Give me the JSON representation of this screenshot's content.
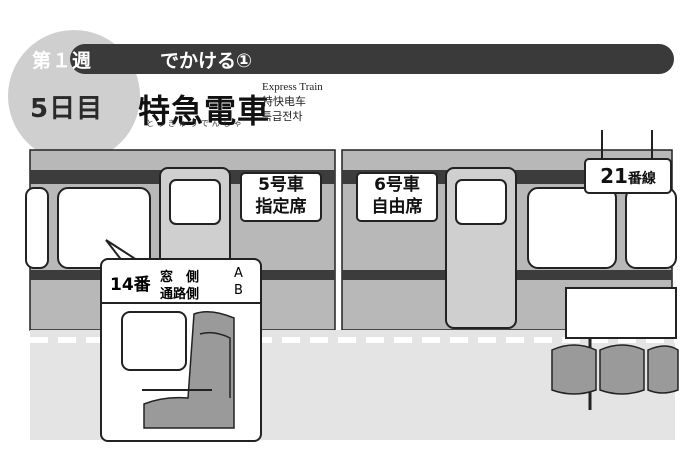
{
  "header": {
    "week": "第１週",
    "title": "でかける①",
    "day": "5日目",
    "heading": "特急電車",
    "reading": "とっきゅうでんしゃ",
    "translations": [
      "Express Train",
      "特快电车",
      "특급전차"
    ]
  },
  "train": {
    "car5": {
      "number": "5号車",
      "type": "指定席"
    },
    "car6": {
      "number": "6号車",
      "type": "自由席"
    }
  },
  "platform_sign": {
    "prefix": "21",
    "suffix": "番線"
  },
  "seat_info": {
    "number": "14番",
    "rows": [
      {
        "label": "窓　側",
        "letter": "A"
      },
      {
        "label": "通路側",
        "letter": "B"
      }
    ]
  },
  "colors": {
    "band": "#3a3a3a",
    "circle": "#cfcfcf",
    "train_body": "#b8b8b8",
    "stripe": "#3c3c3c"
  }
}
